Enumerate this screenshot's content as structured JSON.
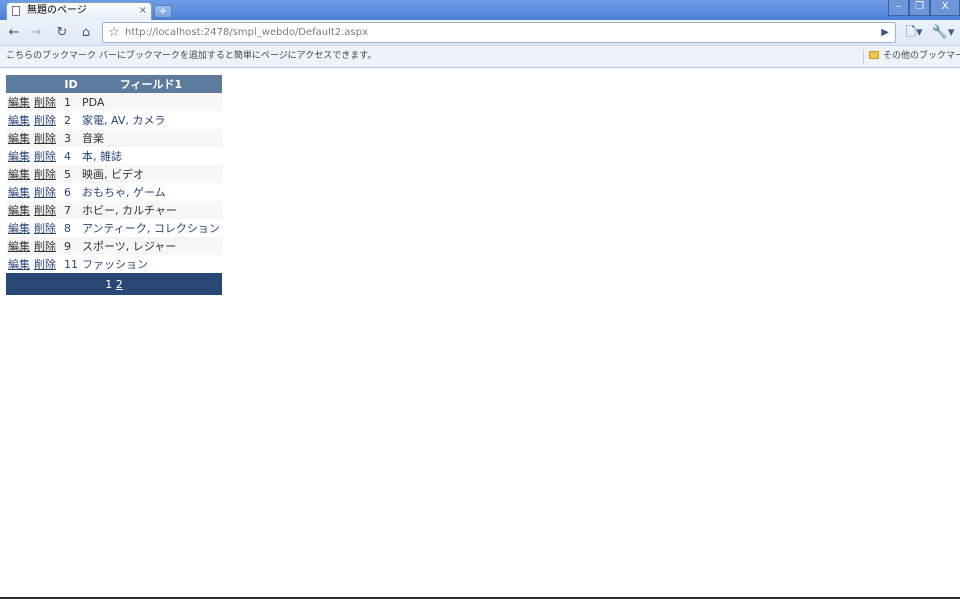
{
  "browser": {
    "tab_title": "無題のページ",
    "tab_close": "×",
    "new_tab": "+",
    "win_min": "–",
    "win_max": "❐",
    "win_close": "X",
    "url": "http://localhost:2478/smpl_webdo/Default2.aspx",
    "bookmark_hint": "こちらのブックマーク バーにブックマークを追加すると簡単にページにアクセスできます。",
    "other_bookmarks": "その他のブックマーク"
  },
  "grid": {
    "headers": {
      "cmd": "",
      "id": "ID",
      "field": "フィールド1"
    },
    "edit_label": "編集",
    "delete_label": "削除",
    "rows": [
      {
        "id": "1",
        "field": "PDA"
      },
      {
        "id": "2",
        "field": "家電, AV, カメラ"
      },
      {
        "id": "3",
        "field": "音楽"
      },
      {
        "id": "4",
        "field": "本, 雑誌"
      },
      {
        "id": "5",
        "field": "映画, ビデオ"
      },
      {
        "id": "6",
        "field": "おもちゃ, ゲーム"
      },
      {
        "id": "7",
        "field": "ホビー, カルチャー"
      },
      {
        "id": "8",
        "field": "アンティーク, コレクション"
      },
      {
        "id": "9",
        "field": "スポーツ, レジャー"
      },
      {
        "id": "11",
        "field": "ファッション"
      }
    ],
    "pager": {
      "current": "1",
      "next": "2"
    }
  },
  "colors": {
    "header_bg": "#5d7b9d",
    "alt_row_bg": "#f7f6f3",
    "pager_bg": "#284775"
  }
}
